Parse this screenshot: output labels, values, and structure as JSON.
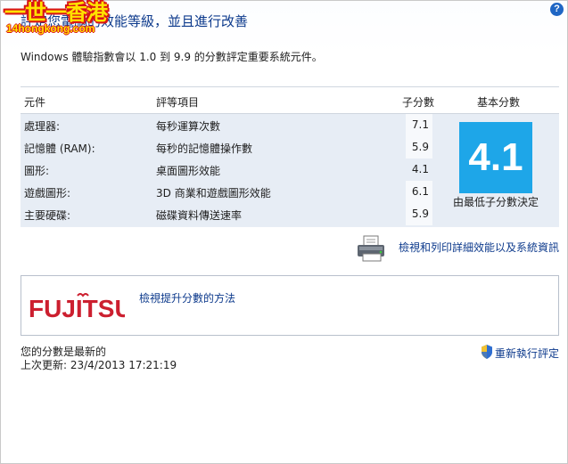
{
  "window": {
    "title": "評定您電腦的效能等級，並且進行改善",
    "help_icon": "help-icon",
    "help_glyph": "?"
  },
  "watermark": {
    "line1": "一世一香港",
    "line2": "14hongkong.com"
  },
  "intro": {
    "text": "Windows 體驗指數會以 1.0 到 9.9 的分數評定重要系統元件。"
  },
  "score_table": {
    "headers": {
      "component": "元件",
      "rating": "評等項目",
      "subscore": "子分數",
      "base_score": "基本分數"
    },
    "rows": [
      {
        "component": "處理器:",
        "rating": "每秒運算次數",
        "subscore": "7.1"
      },
      {
        "component": "記憶體 (RAM):",
        "rating": "每秒的記憶體操作數",
        "subscore": "5.9"
      },
      {
        "component": "圖形:",
        "rating": "桌面圖形效能",
        "subscore": "4.1"
      },
      {
        "component": "遊戲圖形:",
        "rating": "3D 商業和遊戲圖形效能",
        "subscore": "6.1"
      },
      {
        "component": "主要硬碟:",
        "rating": "磁碟資料傳送速率",
        "subscore": "5.9"
      }
    ],
    "base_score": "4.1",
    "base_caption": "由最低子分數決定"
  },
  "print_link": {
    "label": "檢視和列印詳細效能以及系統資訊",
    "icon": "printer-icon"
  },
  "oem": {
    "logo_text": "FUJITSU",
    "link": "檢視提升分數的方法"
  },
  "status": {
    "current": "您的分數是最新的",
    "last_update": "上次更新: 23/4/2013 17:21:19"
  },
  "rerun": {
    "label": "重新執行評定",
    "icon": "shield-icon"
  },
  "colors": {
    "accent": "#0d3a8c",
    "tile": "#1ea6e8",
    "row_bg": "#e7edf5",
    "fujitsu_red": "#cc1f2f"
  }
}
